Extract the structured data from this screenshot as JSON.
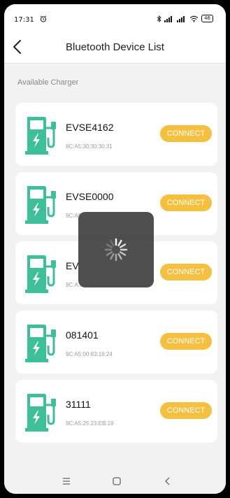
{
  "status": {
    "time": "17:31",
    "battery": "46"
  },
  "header": {
    "title": "Bluetooth Device List"
  },
  "section_label": "Available Charger",
  "devices": [
    {
      "name": "EVSE4162",
      "mac": "9C:A5:30:30:30:31",
      "connect_label": "CONNECT"
    },
    {
      "name": "EVSE0000",
      "mac": "9C:A5:…",
      "connect_label": "CONNECT"
    },
    {
      "name": "EV",
      "mac": "9C:A…",
      "connect_label": "CONNECT"
    },
    {
      "name": "081401",
      "mac": "9C:A5:00:83:16:24",
      "connect_label": "CONNECT"
    },
    {
      "name": "31111",
      "mac": "9C:A5:25:23:EB:19",
      "connect_label": "CONNECT"
    }
  ],
  "colors": {
    "accent": "#f5c040",
    "charger_icon": "#3dbf99",
    "overlay": "#404040"
  }
}
